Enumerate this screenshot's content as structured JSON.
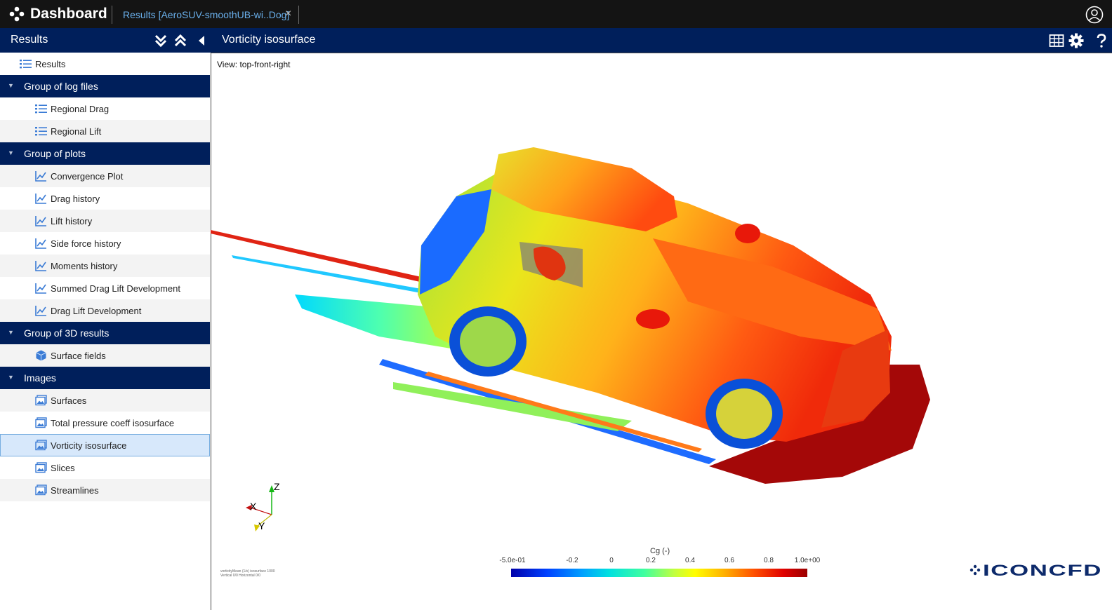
{
  "app": {
    "title": "Dashboard",
    "tab_label": "Results [AeroSUV-smoothUB-wi..Dog]",
    "tab_close": "×"
  },
  "sidebar": {
    "title": "Results",
    "root_item": "Results",
    "groups": [
      {
        "label": "Group of log files",
        "items": [
          "Regional Drag",
          "Regional Lift"
        ]
      },
      {
        "label": "Group of plots",
        "items": [
          "Convergence Plot",
          "Drag history",
          "Lift history",
          "Side force history",
          "Moments history",
          "Summed Drag Lift Development",
          "Drag Lift Development"
        ]
      },
      {
        "label": "Group of 3D results",
        "items": [
          "Surface fields"
        ]
      },
      {
        "label": "Images",
        "items": [
          "Surfaces",
          "Total pressure coeff isosurface",
          "Vorticity isosurface",
          "Slices",
          "Streamlines"
        ]
      }
    ],
    "selected_item": "Vorticity isosurface"
  },
  "viewer": {
    "title": "Vorticity isosurface",
    "view_label": "View: top-front-right",
    "axes": {
      "z": "Z",
      "x": "X",
      "y": "Y"
    },
    "footnote_line1": "vorticityMean (1/s) isosurface 1000",
    "footnote_line2": "Vertical 0/0 Horizontal 0/0"
  },
  "colorbar": {
    "title": "Cg (-)",
    "ticks": [
      "-5.0e-01",
      "-0.2",
      "0",
      "0.2",
      "0.4",
      "0.6",
      "0.8",
      "1.0e+00"
    ],
    "colors": [
      "#0000aa",
      "#00a0ff",
      "#40ff9f",
      "#ffff00",
      "#ff5000",
      "#9a0000"
    ]
  },
  "brand_logo": "ICONCFD",
  "icons": {
    "app": "dashboard-logo-icon",
    "user": "user-account-icon",
    "expand_all": "chevron-double-down-icon",
    "collapse_all": "chevron-double-up-icon",
    "collapse_panel": "caret-left-icon",
    "table": "table-grid-icon",
    "settings": "gear-icon",
    "help": "question-icon"
  }
}
